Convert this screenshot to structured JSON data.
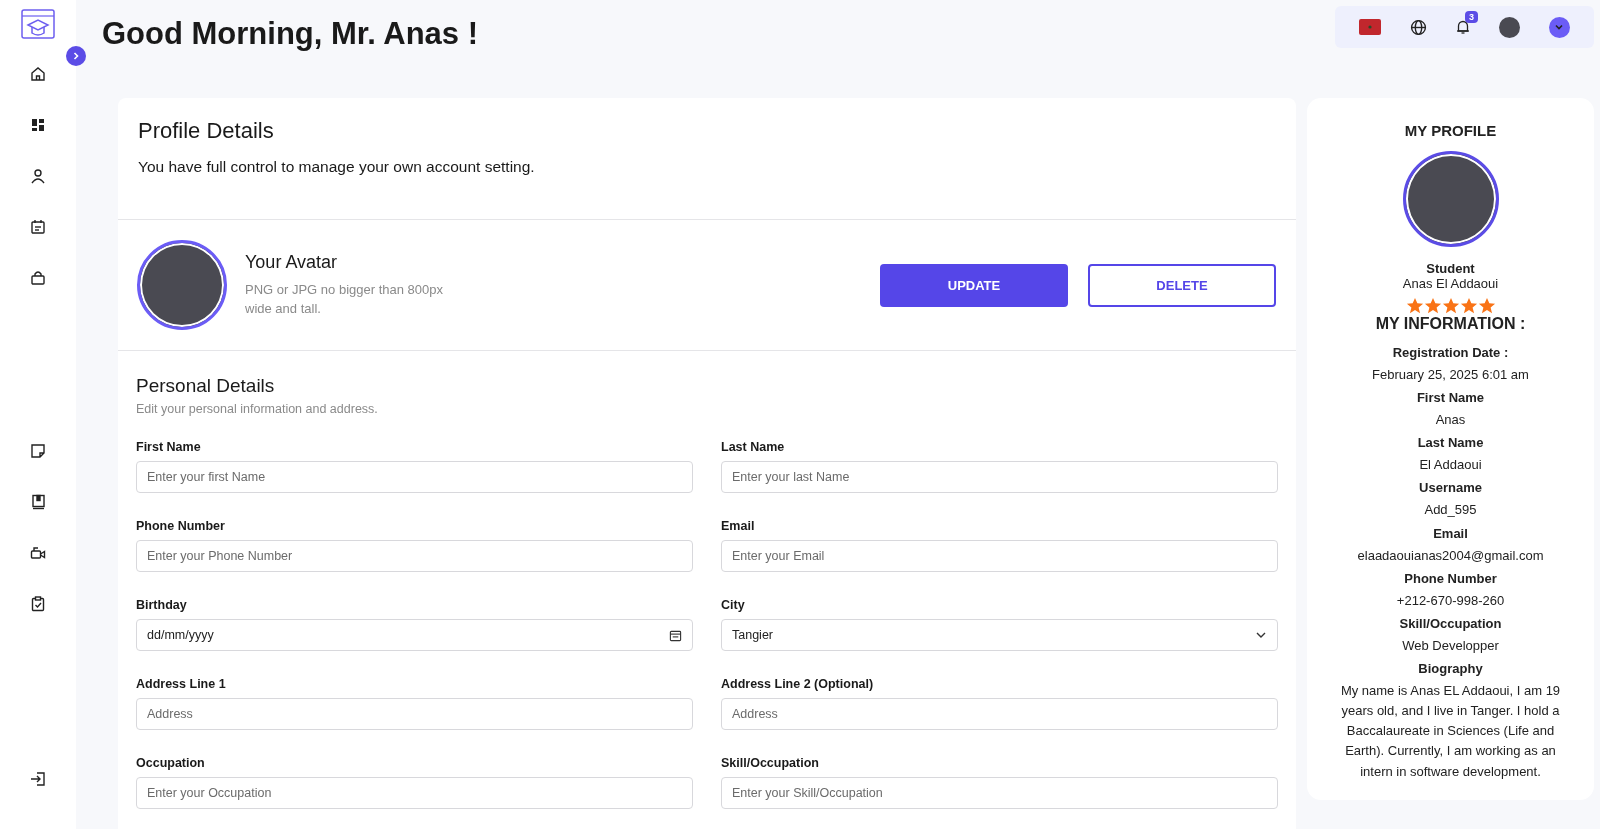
{
  "header": {
    "greeting": "Good Morning, Mr. Anas !"
  },
  "topbar": {
    "notification_count": "3"
  },
  "profile_card": {
    "title": "Profile Details",
    "subtitle": "You have full control to manage your own account setting.",
    "avatar": {
      "title": "Your Avatar",
      "hint": "PNG or JPG no bigger than 800px wide and tall.",
      "buttons": [
        {
          "label": "UPDATE",
          "kind": "primary"
        },
        {
          "label": "DELETE",
          "kind": "outline"
        }
      ]
    },
    "personal": {
      "title": "Personal Details",
      "subtitle": "Edit your personal information and address.",
      "fields": [
        {
          "label": "First Name",
          "kind": "text",
          "placeholder": "Enter your first Name"
        },
        {
          "label": "Last Name",
          "kind": "text",
          "placeholder": "Enter your last Name"
        },
        {
          "label": "Phone Number",
          "kind": "text",
          "placeholder": "Enter your Phone Number"
        },
        {
          "label": "Email",
          "kind": "text",
          "placeholder": "Enter your Email"
        },
        {
          "label": "Birthday",
          "kind": "date",
          "placeholder": "dd/mm/yyyy"
        },
        {
          "label": "City",
          "kind": "select",
          "value": "Tangier"
        },
        {
          "label": "Address Line 1",
          "kind": "text",
          "placeholder": "Address"
        },
        {
          "label": "Address Line 2 (Optional)",
          "kind": "text",
          "placeholder": "Address"
        },
        {
          "label": "Occupation",
          "kind": "text",
          "placeholder": "Enter your Occupation"
        },
        {
          "label": "Skill/Occupation",
          "kind": "text",
          "placeholder": "Enter your Skill/Occupation"
        }
      ]
    }
  },
  "my_profile": {
    "title": "MY PROFILE",
    "role": "Student",
    "name": "Anas El Addaoui",
    "stars": 5,
    "info_title": "MY INFORMATION :",
    "info": [
      {
        "label": "Registration Date :",
        "value": "February 25, 2025 6:01 am"
      },
      {
        "label": "First Name",
        "value": "Anas"
      },
      {
        "label": "Last Name",
        "value": "El Addaoui"
      },
      {
        "label": "Username",
        "value": "Add_595"
      },
      {
        "label": "Email",
        "value": "elaadaouianas2004@gmail.com"
      },
      {
        "label": "Phone Number",
        "value": "+212-670-998-260"
      },
      {
        "label": "Skill/Occupation",
        "value": "Web Developper"
      },
      {
        "label": "Biography",
        "value": "My name is Anas EL Addaoui, I am 19 years old, and I live in Tanger. I hold a Baccalaureate in Sciences (Life and Earth). Currently, I am working as an intern in software development."
      }
    ]
  }
}
